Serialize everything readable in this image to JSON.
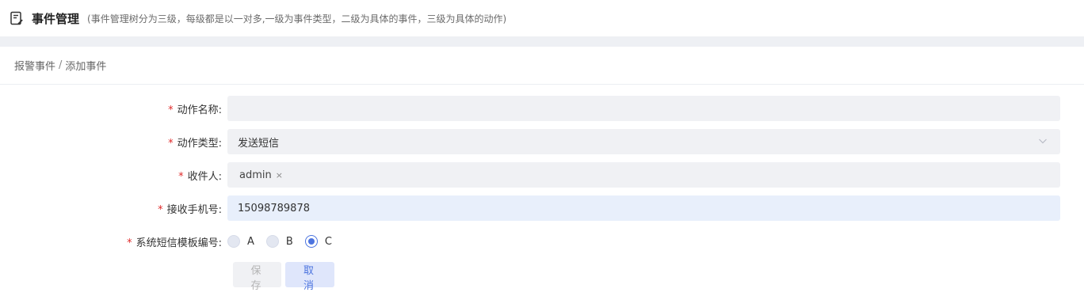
{
  "header": {
    "title": "事件管理",
    "subtitle": "(事件管理树分为三级，每级都是以一对多,一级为事件类型，二级为具体的事件，三级为具体的动作)"
  },
  "breadcrumb": {
    "parent": "报警事件",
    "separator": "/",
    "current": "添加事件"
  },
  "form": {
    "required_mark": "*",
    "action_name": {
      "label": "动作名称:",
      "value": "",
      "placeholder": ""
    },
    "action_type": {
      "label": "动作类型:",
      "value": "发送短信"
    },
    "recipient": {
      "label": "收件人:",
      "tags": [
        "admin"
      ],
      "tag_close": "×"
    },
    "phone": {
      "label": "接收手机号:",
      "value": "15098789878"
    },
    "sms_template": {
      "label": "系统短信模板编号:",
      "options": [
        "A",
        "B",
        "C"
      ],
      "selected": "C"
    }
  },
  "buttons": {
    "save": "保存",
    "cancel": "取消"
  },
  "colors": {
    "accent": "#4c74df",
    "required": "#e02b2b",
    "field_bg": "#f0f1f4",
    "phone_field_bg": "#e8effb"
  }
}
